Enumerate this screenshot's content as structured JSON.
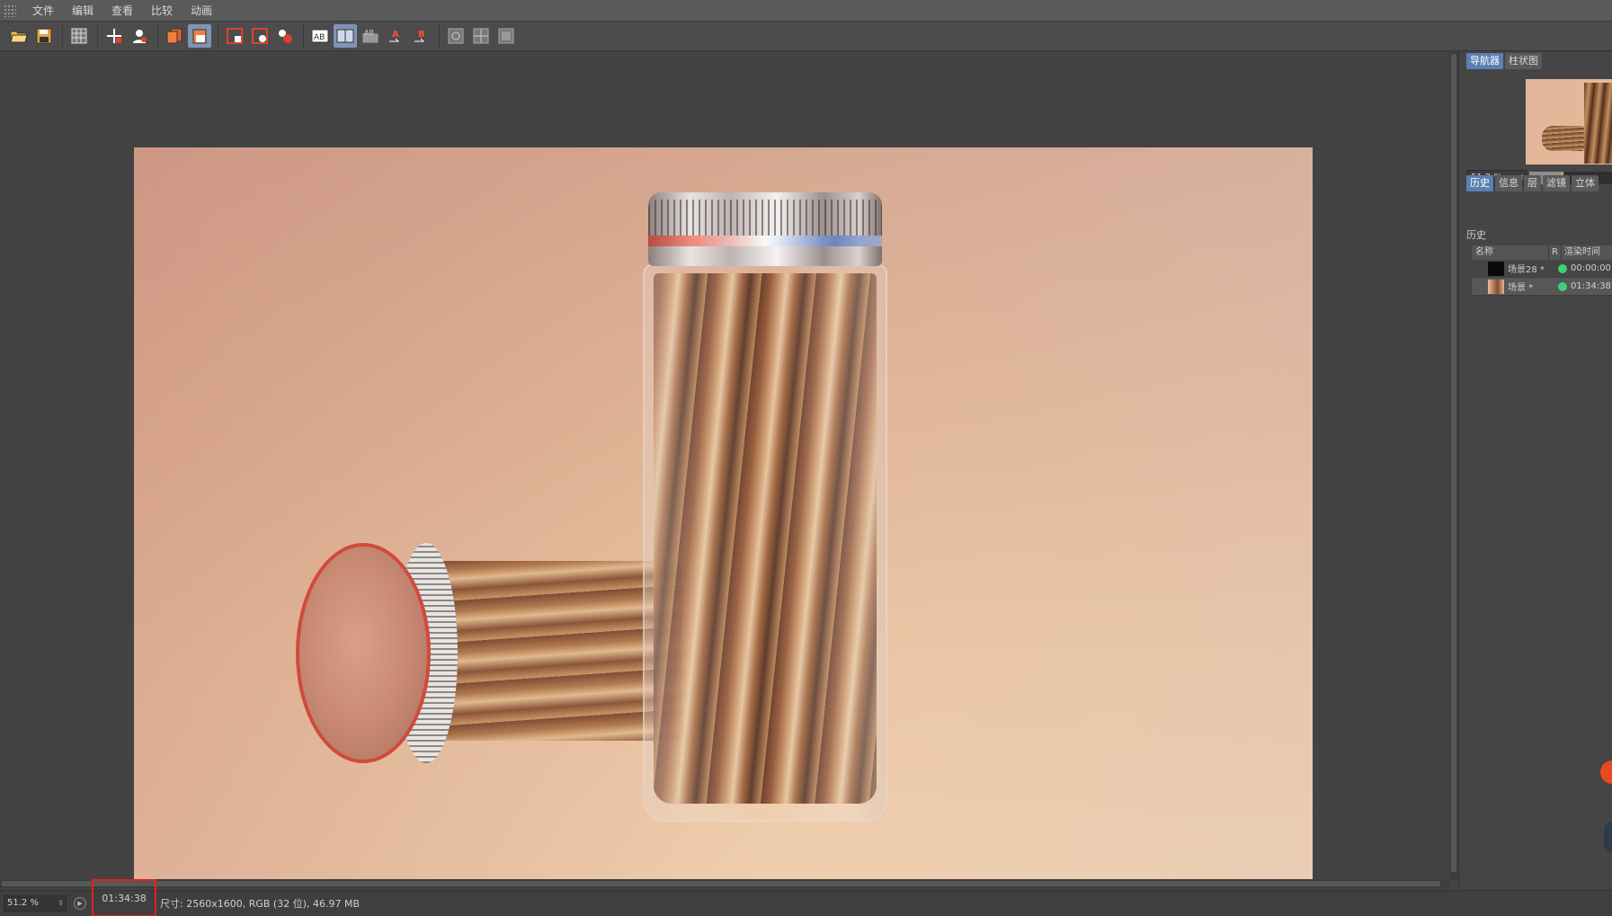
{
  "menu": {
    "items": [
      "文件",
      "编辑",
      "查看",
      "比较",
      "动画"
    ]
  },
  "toolbar": {
    "groups": [
      [
        "open-folder-icon",
        "save-icon"
      ],
      [
        "grid-icon"
      ],
      [
        "crosshair-move-icon",
        "user-pin-icon"
      ],
      [
        "copy-layer-icon",
        "paste-layer-icon"
      ],
      [
        "region-render-icon",
        "region-select-icon",
        "multi-region-icon"
      ],
      [
        "ab-compare-icon",
        "split-compare-icon",
        "ab-overlay-icon",
        "set-a-icon",
        "set-b-icon"
      ],
      [
        "lut-icon",
        "stereo-icon",
        "filter-icon"
      ]
    ],
    "active": [
      "paste-layer-icon",
      "split-compare-icon"
    ]
  },
  "panel": {
    "top_tabs": [
      "导航器",
      "柱状图"
    ],
    "zoom_value": "51.2 %",
    "zoom_fraction": 0.4,
    "mid_tabs": [
      "历史",
      "信息",
      "层",
      "滤镜",
      "立体"
    ],
    "section_title": "历史",
    "history_headers": {
      "name": "名称",
      "r": "R",
      "render_time": "渲染时间"
    },
    "history_rows": [
      {
        "name": "场景28 *",
        "time": "00:00:00",
        "status_color": "#3fd07a"
      },
      {
        "name": "场景 *",
        "time": "01:34:38",
        "status_color": "#3fd07a"
      }
    ]
  },
  "status": {
    "zoom": "51.2 %",
    "render_time": "01:34:38",
    "info": "尺寸: 2560x1600, RGB (32 位), 46.97 MB"
  },
  "colors": {
    "accent": "#5b7fb0",
    "highlight_box": "#e02020"
  }
}
